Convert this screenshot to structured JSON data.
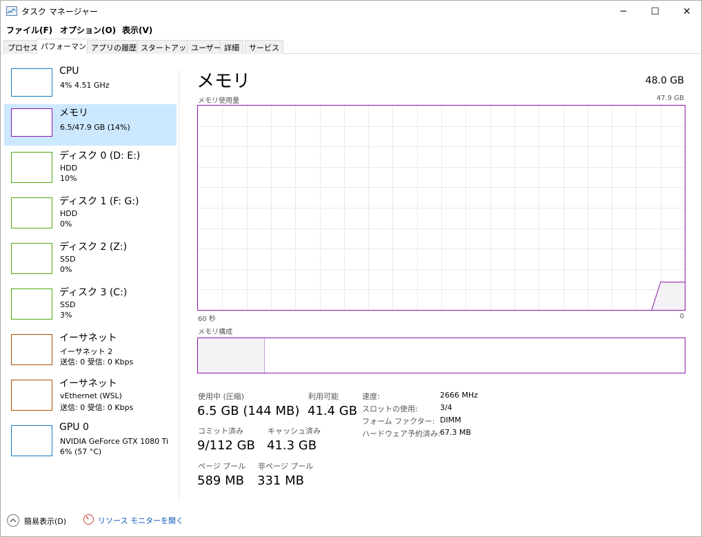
{
  "window": {
    "title": "タスク マネージャー",
    "minimize": "─",
    "maximize": "☐",
    "close": "✕"
  },
  "menu": {
    "file": "ファイル(F)",
    "options": "オプション(O)",
    "view": "表示(V)"
  },
  "tabs": [
    "プロセス",
    "パフォーマンス",
    "アプリの履歴",
    "スタートアップ",
    "ユーザー",
    "詳細",
    "サービス"
  ],
  "sidebar": {
    "items": [
      {
        "title": "CPU",
        "line1": "4%  4.51 GHz",
        "line2": "",
        "color": "#117dbb"
      },
      {
        "title": "メモリ",
        "line1": "6.5/47.9 GB (14%)",
        "line2": "",
        "color": "#8b12ae"
      },
      {
        "title": "ディスク 0 (D: E:)",
        "line1": "HDD",
        "line2": "10%",
        "color": "#4da60c"
      },
      {
        "title": "ディスク 1 (F: G:)",
        "line1": "HDD",
        "line2": "0%",
        "color": "#4da60c"
      },
      {
        "title": "ディスク 2 (Z:)",
        "line1": "SSD",
        "line2": "0%",
        "color": "#4da60c"
      },
      {
        "title": "ディスク 3 (C:)",
        "line1": "SSD",
        "line2": "3%",
        "color": "#4da60c"
      },
      {
        "title": "イーサネット",
        "line1": "イーサネット 2",
        "line2": "送信: 0 受信: 0 Kbps",
        "color": "#a74f01"
      },
      {
        "title": "イーサネット",
        "line1": "vEthernet (WSL)",
        "line2": "送信: 0 受信: 0 Kbps",
        "color": "#a74f01"
      },
      {
        "title": "GPU 0",
        "line1": "NVIDIA GeForce GTX 1080 Ti",
        "line2": "6% (57 °C)",
        "color": "#117dbb"
      }
    ]
  },
  "main": {
    "title": "メモリ",
    "total": "48.0 GB",
    "usage_label": "メモリ使用量",
    "usage_max": "47.9 GB",
    "time_left": "60 秒",
    "time_right": "0",
    "composition_label": "メモリ構成",
    "composition_used_fraction": 0.137,
    "graph_usage_recent_fraction": 0.136,
    "accent_color": "#8b12ae"
  },
  "stats": {
    "in_use_label": "使用中 (圧縮)",
    "in_use_value": "6.5 GB (144 MB)",
    "available_label": "利用可能",
    "available_value": "41.4 GB",
    "committed_label": "コミット済み",
    "committed_value": "9/112 GB",
    "cached_label": "キャッシュ済み",
    "cached_value": "41.3 GB",
    "paged_label": "ページ プール",
    "paged_value": "589 MB",
    "nonpaged_label": "非ページ プール",
    "nonpaged_value": "331 MB"
  },
  "specs": [
    {
      "label": "速度:",
      "value": "2666 MHz"
    },
    {
      "label": "スロットの使用:",
      "value": "3/4"
    },
    {
      "label": "フォーム ファクター:",
      "value": "DIMM"
    },
    {
      "label": "ハードウェア予約済み:",
      "value": "67.3 MB"
    }
  ],
  "footer": {
    "collapse": "簡易表示(D)",
    "resource_monitor": "リソース モニターを開く"
  }
}
